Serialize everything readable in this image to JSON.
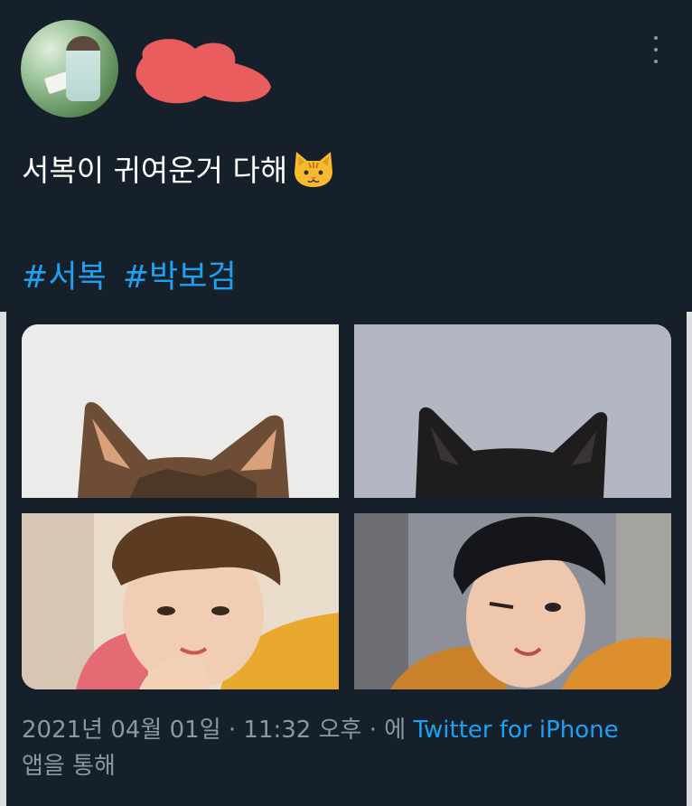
{
  "user": {
    "name": "",
    "handle": ""
  },
  "tweet": {
    "text": "서복이 귀여운거 다해",
    "emoji": "cat-face",
    "hashtags": [
      "#서복",
      "#박보검"
    ]
  },
  "media": {
    "count": 4
  },
  "meta": {
    "timestamp": "2021년 04월 01일 · 11:32 오후 · 에",
    "source": "Twitter for iPhone",
    "suffix": "앱을 통해"
  },
  "colors": {
    "background": "#15202b",
    "text": "#ffffff",
    "secondary": "#8899a6",
    "accent": "#1da1f2",
    "redaction": "#ea5d5f"
  }
}
